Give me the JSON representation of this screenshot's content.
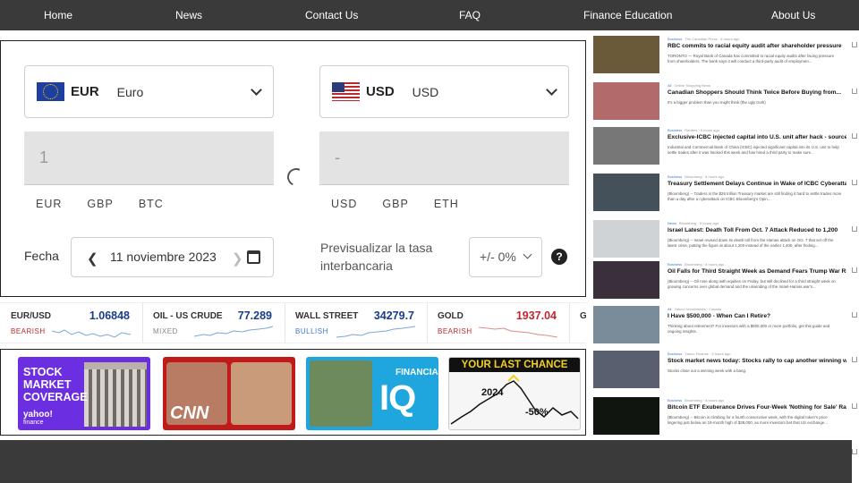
{
  "nav": [
    "Home",
    "News",
    "Contact Us",
    "FAQ",
    "Finance Education",
    "About Us"
  ],
  "converter": {
    "from": {
      "code": "EUR",
      "name": "Euro",
      "flag": "eu-flag",
      "amount": "1"
    },
    "to": {
      "code": "USD",
      "name": "USD",
      "flag": "us-flag",
      "amount": "-"
    },
    "from_quick": [
      "EUR",
      "GBP",
      "BTC"
    ],
    "to_quick": [
      "USD",
      "GBP",
      "ETH"
    ],
    "date_label": "Fecha",
    "date_value": "11 noviembre 2023",
    "prev_glyph": "❮",
    "next_glyph": "❯",
    "previs_label": "Previsualizar la tasa interbancaria",
    "pct_value": "+/- 0%",
    "help": "?"
  },
  "ticker": [
    {
      "name": "EUR/USD",
      "price": "1.06848",
      "trend": "BEARISH",
      "color": "#1a3c8c",
      "trend_color": "#c0262d"
    },
    {
      "name": "OIL - US CRUDE",
      "price": "77.289",
      "trend": "MIXED",
      "color": "#1a3c8c",
      "trend_color": "#888888"
    },
    {
      "name": "WALL STREET",
      "price": "34279.7",
      "trend": "BULLISH",
      "color": "#1a3c8c",
      "trend_color": "#3a7bd5"
    },
    {
      "name": "GOLD",
      "price": "1937.04",
      "trend": "BEARISH",
      "color": "#c0262d",
      "trend_color": "#c0262d"
    },
    {
      "name": "GB",
      "price": "",
      "trend": "",
      "color": "#1a3c8c",
      "trend_color": "#888888"
    }
  ],
  "videos": {
    "v1_line1": "STOCK",
    "v1_line2": "MARKET",
    "v1_line3": "COVERAGE",
    "v1_brand_a": "yahoo!",
    "v1_brand_b": "finance",
    "v2_brand": "CNN",
    "v3_top": "FINANCIAL",
    "v3_big": "IQ",
    "v4_head": "YOUR LAST CHANCE",
    "v4_year": "2024",
    "v4_pct": "-50%"
  },
  "news": [
    {
      "cat": "Business",
      "meta": "The Canadian Press · 6 hours ago",
      "title": "RBC commits to racial equity audit after shareholder pressure",
      "summary": "TORONTO — Royal Bank of Canada has committed to racial equity audits after facing pressure from shareholders. The bank says it will conduct a third-party audit of employmen...",
      "img": "#6b5a3a"
    },
    {
      "cat": "All",
      "meta": "Online Shopping News",
      "title": "Canadian Shoppers Should Think Twice Before Buying from...",
      "summary": "It's a bigger problem than you might think (the ugly truth)",
      "img": "#b36a6a"
    },
    {
      "cat": "Business",
      "meta": "Reuters · 6 hours ago",
      "title": "Exclusive-ICBC injected capital into U.S. unit after hack - sources",
      "summary": "Industrial and Commercial Bank of China (ICBC) injected significant capital into its U.S. unit to help settle trades after it was hacked this week and has hired a third party to make sure...",
      "img": "#777777"
    },
    {
      "cat": "Business",
      "meta": "Bloomberg · 8 hours ago",
      "title": "Treasury Settlement Delays Continue in Wake of ICBC Cyberattack",
      "summary": "(Bloomberg) -- Traders in the $26 trillion Treasury market are still finding it hard to settle trades more than a day after a cyberattack on ICBC Bloomberg's Opin...",
      "img": "#44505a"
    },
    {
      "cat": "News",
      "meta": "Bloomberg · 8 hours ago",
      "title": "Israel Latest: Death Toll From Oct. 7 Attack Reduced to 1,200",
      "summary": "(Bloomberg) -- Israel revised down its death toll from the Hamas attack on Oct. 7 that set off the latest crisis, putting the figure at about 1,200 instead of the earlier 1,400, after finding...",
      "img": "#cfd3d6"
    },
    {
      "cat": "Business",
      "meta": "Bloomberg · 8 hours ago",
      "title": "Oil Falls for Third Straight Week as Demand Fears Trump War Risk",
      "summary": "(Bloomberg) -- Oil rose along with equities on Friday, but still declined for a third straight week on growing concerns over global demand and the unwinding of the Israel-Hamas war's...",
      "img": "#3a2f3a"
    },
    {
      "cat": "All",
      "meta": "Yahoo! Investments · Canada",
      "title": "I Have $500,000 - When Can I Retire?",
      "summary": "Thinking about retirement? For investors with a $500,000 or more portfolio, get this guide and ongoing insights.",
      "img": "#7a8c9a"
    },
    {
      "cat": "Business",
      "meta": "Yahoo Finance · 6 hours ago",
      "title": "Stock market news today: Stocks rally to cap another winning week",
      "summary": "Stocks close out a winning week with a bang.",
      "img": "#5a5f70"
    },
    {
      "cat": "Business",
      "meta": "Bloomberg · 8 hours ago",
      "title": "Bitcoin ETF Exuberance Drives Four-Week 'Nothing for Sale' Rally",
      "summary": "(Bloomberg) -- Bitcoin is climbing for a fourth consecutive week, with the digital token's price lingering just below an 18-month high of $38,000, as more investors bet that US exchange...",
      "img": "#101510"
    }
  ]
}
